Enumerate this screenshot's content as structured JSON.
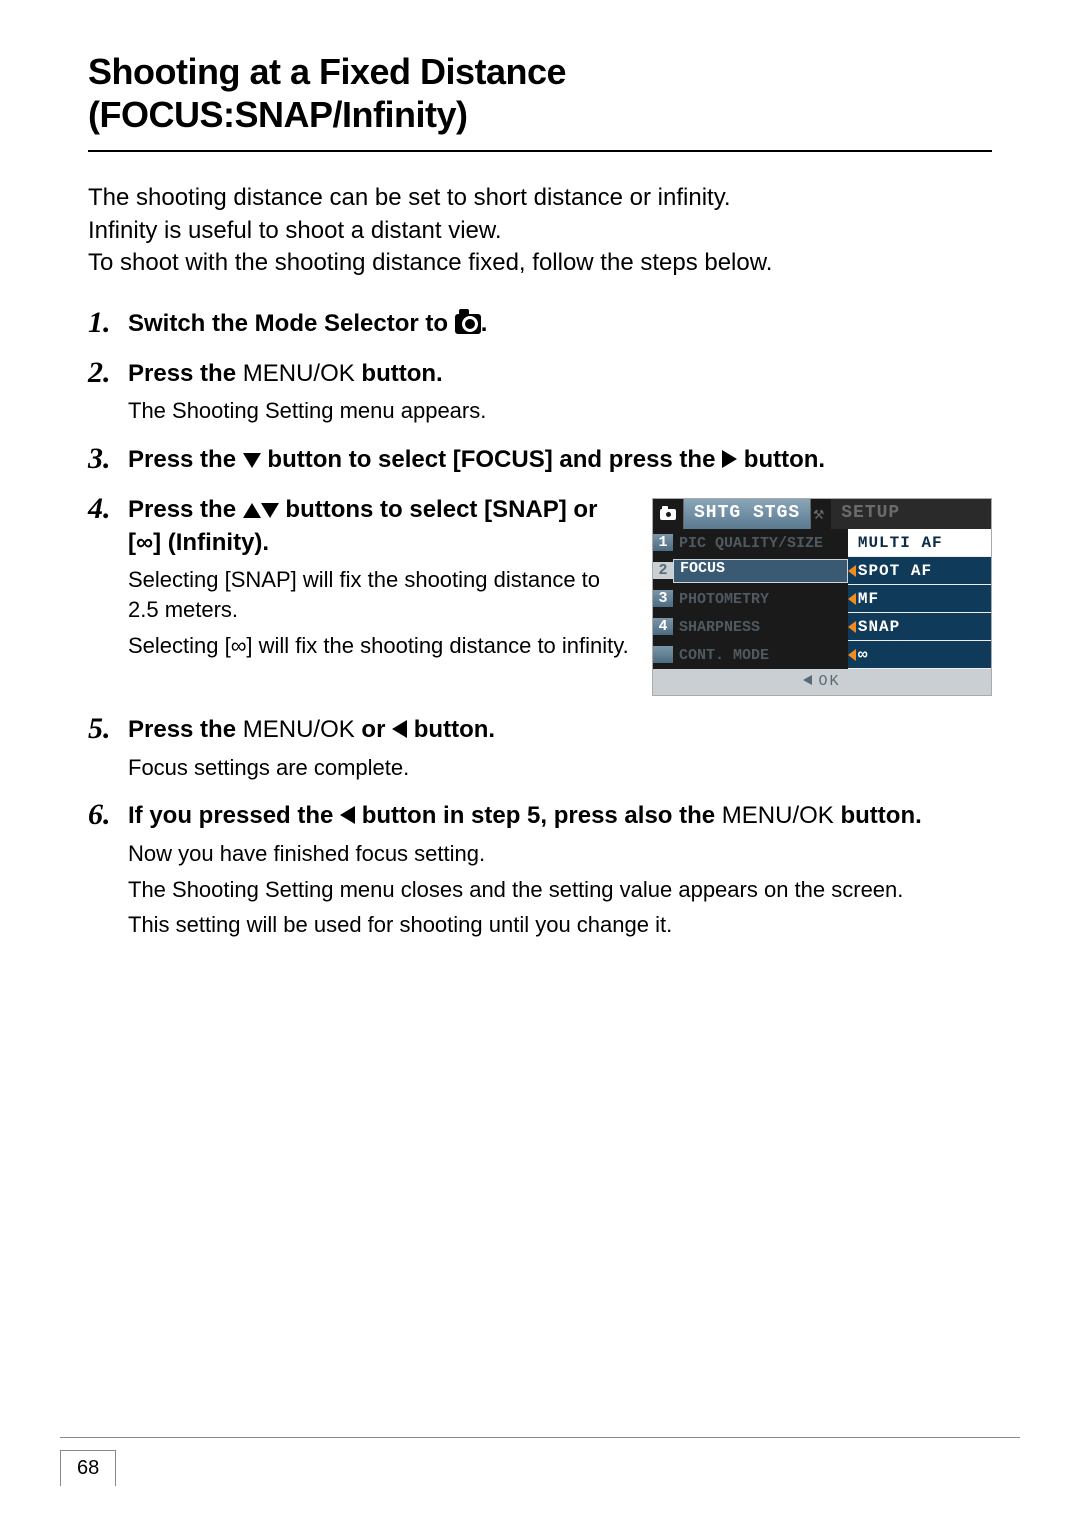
{
  "page_number": "68",
  "title_line1": "Shooting at a Fixed Distance",
  "title_line2": "(FOCUS:SNAP/Infinity)",
  "intro_line1": "The shooting distance can be set to short distance or infinity.",
  "intro_line2": "Infinity is useful to shoot a distant view.",
  "intro_line3": "To shoot with the shooting distance fixed, follow the steps below.",
  "steps": {
    "s1_title_a": "Switch the Mode Selector to ",
    "s1_title_b": ".",
    "s2_title_a": "Press the ",
    "s2_menuok": "MENU/OK",
    "s2_title_b": " button.",
    "s2_body": "The Shooting Setting menu appears.",
    "s3_title_a": "Press the ",
    "s3_title_b": " button to select [FOCUS] and press the ",
    "s3_title_c": " button.",
    "s4_title_a": "Press the ",
    "s4_title_b": " buttons to select [SNAP] or [∞] (Infinity).",
    "s4_body1": "Selecting [SNAP] will fix the shooting distance to 2.5 meters.",
    "s4_body2": "Selecting [∞] will fix the shooting distance to infinity.",
    "s5_title_a": "Press the ",
    "s5_title_b": " or ",
    "s5_title_c": " button.",
    "s5_body": "Focus settings are complete.",
    "s6_title_a": "If you pressed the ",
    "s6_title_b": " button in step 5, press also the ",
    "s6_title_c": " button.",
    "s6_body1": "Now you have finished focus setting.",
    "s6_body2": "The Shooting Setting menu closes and the setting value appears on the screen.",
    "s6_body3": "This setting will be used for shooting until you change it."
  },
  "lcd": {
    "tab_active": "SHTG STGS",
    "tab_inactive": "SETUP",
    "left": {
      "r1": "PIC QUALITY/SIZE",
      "r2": "FOCUS",
      "r3": "PHOTOMETRY",
      "r4": "SHARPNESS",
      "r5": "CONT. MODE"
    },
    "right": {
      "r1": "MULTI AF",
      "r2": "SPOT AF",
      "r3": "MF",
      "r4": "SNAP",
      "r5": "∞"
    },
    "footer": "OK"
  }
}
